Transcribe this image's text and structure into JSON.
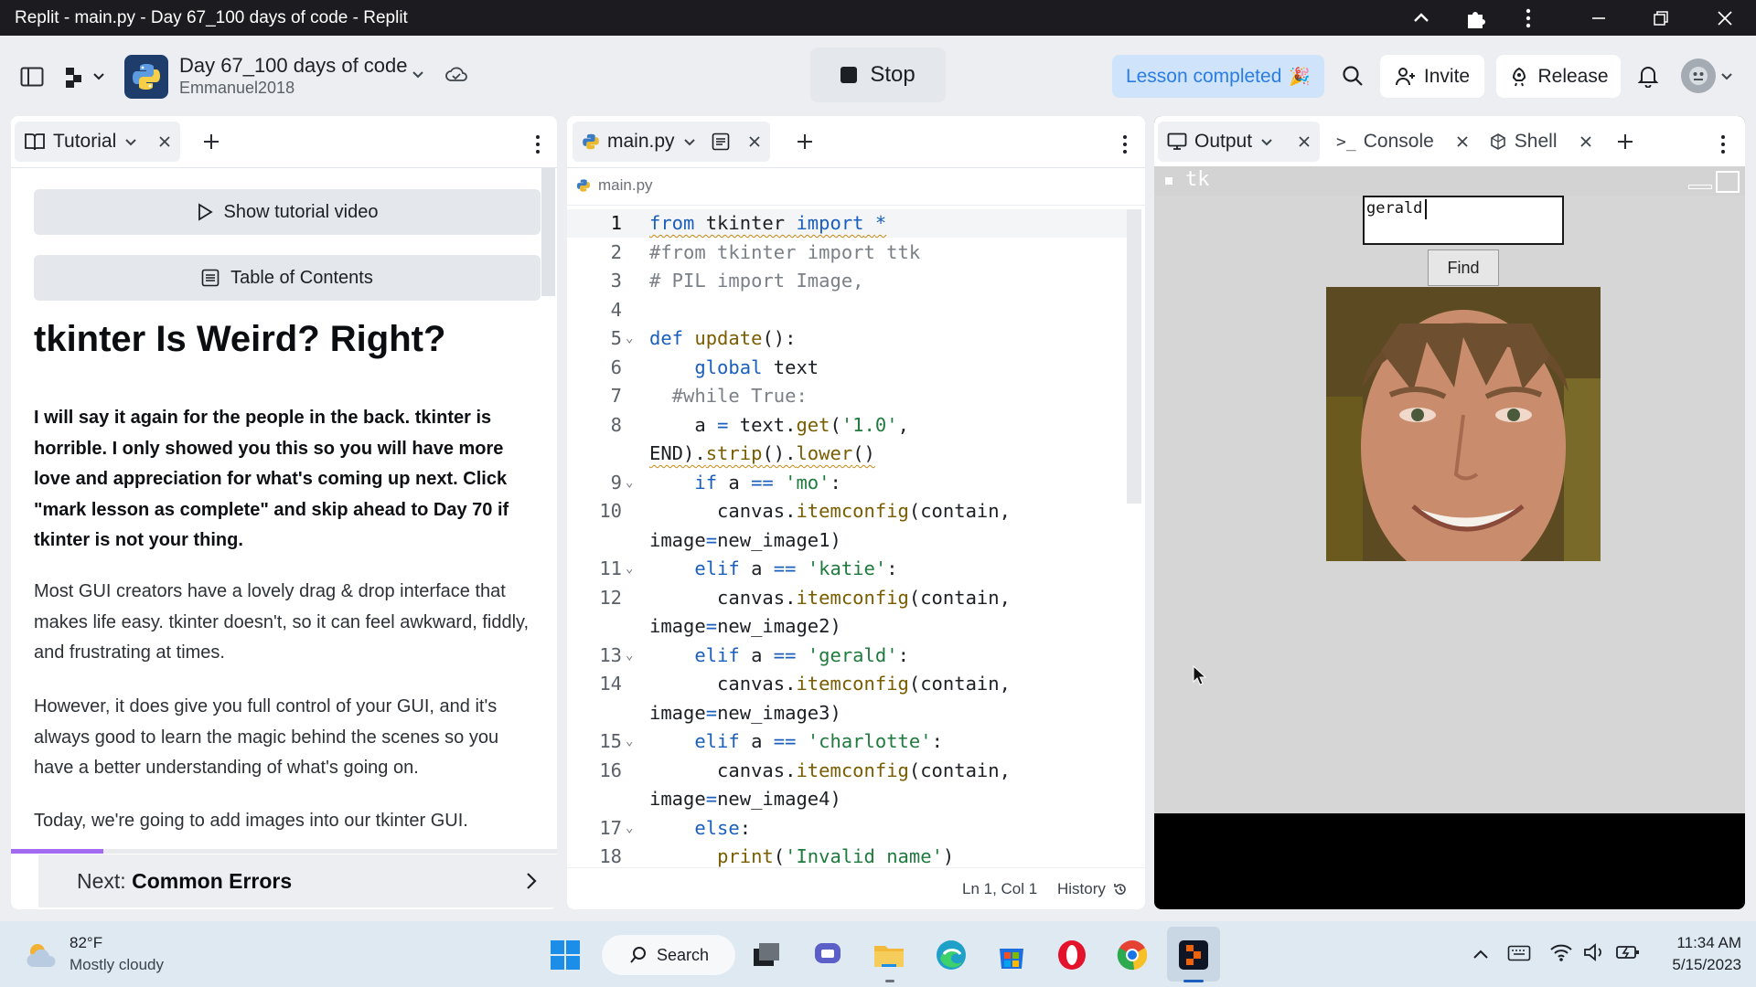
{
  "window": {
    "title": "Replit - main.py - Day 67_100 days of code - Replit"
  },
  "header": {
    "repl_name": "Day 67_100 days of code",
    "owner": "Emmanuel2018",
    "run_button": "Stop",
    "lesson_badge": "Lesson completed",
    "invite_label": "Invite",
    "release_label": "Release"
  },
  "tutorial_pane": {
    "tab_label": "Tutorial",
    "show_video": "Show tutorial video",
    "toc": "Table of Contents",
    "title": "tkinter Is Weird? Right?",
    "para_bold": "I will say it again for the people in the back. tkinter is horrible. I only showed you this so you will have more love and appreciation for what's coming up next. Click \"mark lesson as complete\" and skip ahead to Day 70 if tkinter is not your thing.",
    "para2": "Most GUI creators have a lovely drag & drop interface that makes life easy. tkinter doesn't, so it can feel awkward, fiddly, and frustrating at times.",
    "para3": "However, it does give you full control of your GUI, and it's always good to learn the magic behind the scenes so you have a better understanding of what's going on.",
    "para4": "Today, we're going to add images into our tkinter GUI.",
    "next_prefix": "Next:",
    "next_title": "Common Errors"
  },
  "editor": {
    "tab_label": "main.py",
    "breadcrumb": "main.py",
    "line_numbers": [
      "1",
      "2",
      "3",
      "4",
      "5",
      "6",
      "7",
      "8",
      "9",
      "10",
      "11",
      "12",
      "13",
      "14",
      "15",
      "16",
      "17",
      "18"
    ],
    "status_position": "Ln 1, Col 1",
    "history_label": "History"
  },
  "right_pane": {
    "tabs": [
      "Output",
      "Console",
      "Shell"
    ],
    "tk_title": "tk",
    "entry_value": "gerald",
    "find_button": "Find"
  },
  "taskbar": {
    "temperature": "82°F",
    "weather": "Mostly cloudy",
    "search_label": "Search",
    "time": "11:34 AM",
    "date": "5/15/2023"
  },
  "colors": {
    "accent_lesson_bg": "#cfe4fb",
    "accent_lesson_fg": "#2b7de0",
    "progress_purple": "#a16af0"
  },
  "tutorial_progress": 0.17
}
